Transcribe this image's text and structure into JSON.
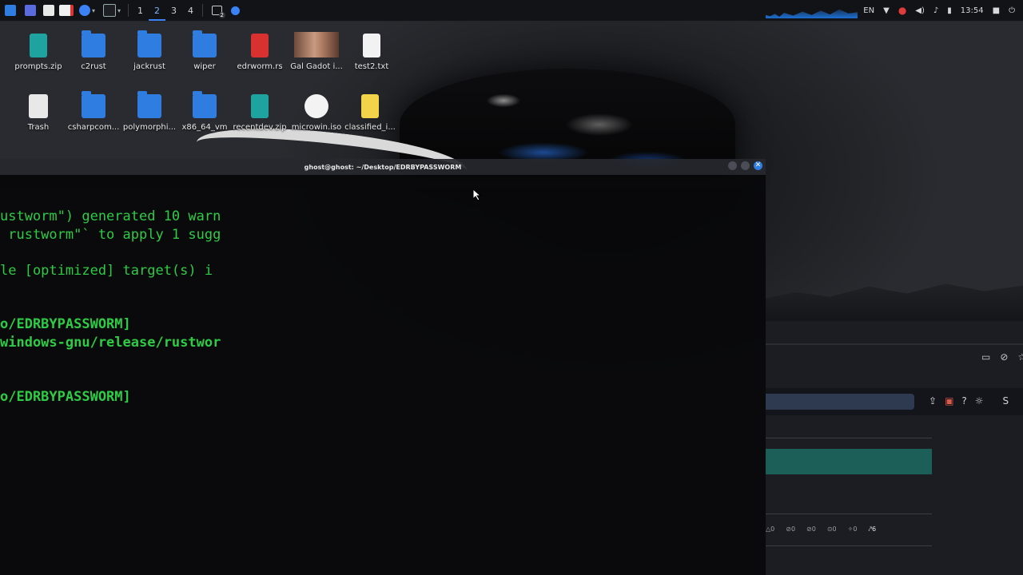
{
  "panel": {
    "workspaces": [
      "1",
      "2",
      "3",
      "4"
    ],
    "active_workspace": "2",
    "window_count_badge": "2",
    "language": "EN",
    "clock": "13:54"
  },
  "desktop": {
    "row1": [
      "prompts.zip",
      "c2rust",
      "jackrust",
      "wiper",
      "edrworm.rs",
      "Gal Gadot i...",
      "test2.txt"
    ],
    "row2": [
      "Trash",
      "csharpcom...",
      "polymorphi...",
      "x86_64_vm",
      "recentdev.zip",
      "microwin.iso",
      "classified_i..."
    ]
  },
  "terminal": {
    "title": "ghost@ghost: ~/Desktop/EDRBYPASSWORM",
    "lines": [
      "ustworm\") generated 10 warn",
      " rustworm\"` to apply 1 sugg",
      "le [optimized] target(s) i",
      "o/EDRBYPASSWORM]",
      "windows-gnu/release/rustwor",
      "o/EDRBYPASSWORM]"
    ],
    "close_glyph": "✕"
  },
  "right_panel": {
    "stats": [
      "△0",
      "⊘0",
      "⊘0",
      "⊙0",
      "✧0",
      "⤤6"
    ],
    "label_s": "S"
  },
  "colors": {
    "terminal_text": "#2ecb45",
    "accent": "#2f7de1",
    "teal_bar": "#1c5e58"
  }
}
